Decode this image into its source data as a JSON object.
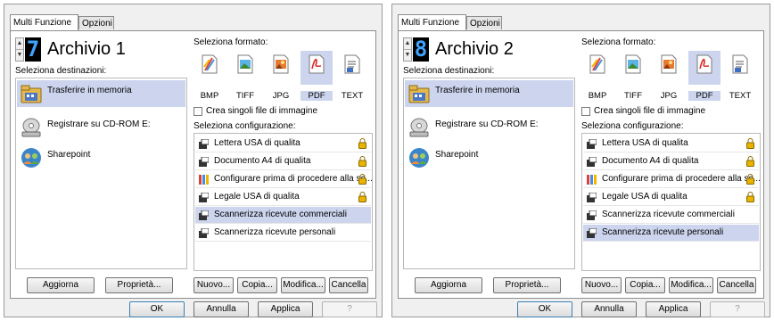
{
  "dialogs": [
    {
      "tabs": [
        "Multi Funzione",
        "Opzioni"
      ],
      "profile_number": "7",
      "profile_name": "Archivio 1",
      "dest_label": "Seleziona destinazioni:",
      "destinations": [
        "Trasferire in memoria",
        "Registrare su CD-ROM  E:",
        "Sharepoint"
      ],
      "format_label": "Seleziona formato:",
      "formats": [
        "BMP",
        "TIFF",
        "JPG",
        "PDF",
        "TEXT"
      ],
      "selected_format": "PDF",
      "checkbox_label": "Crea singoli file di immagine",
      "config_label": "Seleziona configurazione:",
      "configs": [
        "Lettera USA di qualita",
        "Documento A4 di qualita",
        "Configurare prima di procedere alla sc...",
        "Legale USA di qualita",
        "Scannerizza ricevute commerciali",
        "Scannerizza ricevute personali"
      ],
      "selected_config": 4,
      "buttons": {
        "aggiorna": "Aggiorna",
        "proprieta": "Proprietà...",
        "nuovo": "Nuovo...",
        "copia": "Copia...",
        "modifica": "Modifica...",
        "cancella": "Cancella",
        "ok": "OK",
        "annulla": "Annulla",
        "applica": "Applica",
        "help": "?"
      }
    },
    {
      "tabs": [
        "Multi Funzione",
        "Opzioni"
      ],
      "profile_number": "8",
      "profile_name": "Archivio 2",
      "dest_label": "Seleziona destinazioni:",
      "destinations": [
        "Trasferire in memoria",
        "Registrare su CD-ROM  E:",
        "Sharepoint"
      ],
      "format_label": "Seleziona formato:",
      "formats": [
        "BMP",
        "TIFF",
        "JPG",
        "PDF",
        "TEXT"
      ],
      "selected_format": "PDF",
      "checkbox_label": "Crea singoli file di immagine",
      "config_label": "Seleziona configurazione:",
      "configs": [
        "Lettera USA di qualita",
        "Documento A4 di qualita",
        "Configurare prima di procedere alla sc...",
        "Legale USA di qualita",
        "Scannerizza ricevute commerciali",
        "Scannerizza ricevute personali"
      ],
      "selected_config": 5,
      "buttons": {
        "aggiorna": "Aggiorna",
        "proprieta": "Proprietà...",
        "nuovo": "Nuovo...",
        "copia": "Copia...",
        "modifica": "Modifica...",
        "cancella": "Cancella",
        "ok": "OK",
        "annulla": "Annulla",
        "applica": "Applica",
        "help": "?"
      }
    }
  ],
  "colors": {
    "selection": "#cdd5ee",
    "lcd_digit": "#3ea4ff",
    "lock": "#d9a400"
  },
  "icons": {
    "destinations": [
      "memory-folder-icon",
      "cd-rom-icon",
      "sharepoint-icon"
    ],
    "formats": [
      "bmp-icon",
      "tiff-icon",
      "jpg-icon",
      "pdf-icon",
      "text-icon"
    ],
    "config": "scanner-config-icon",
    "lock": "lock-icon"
  }
}
